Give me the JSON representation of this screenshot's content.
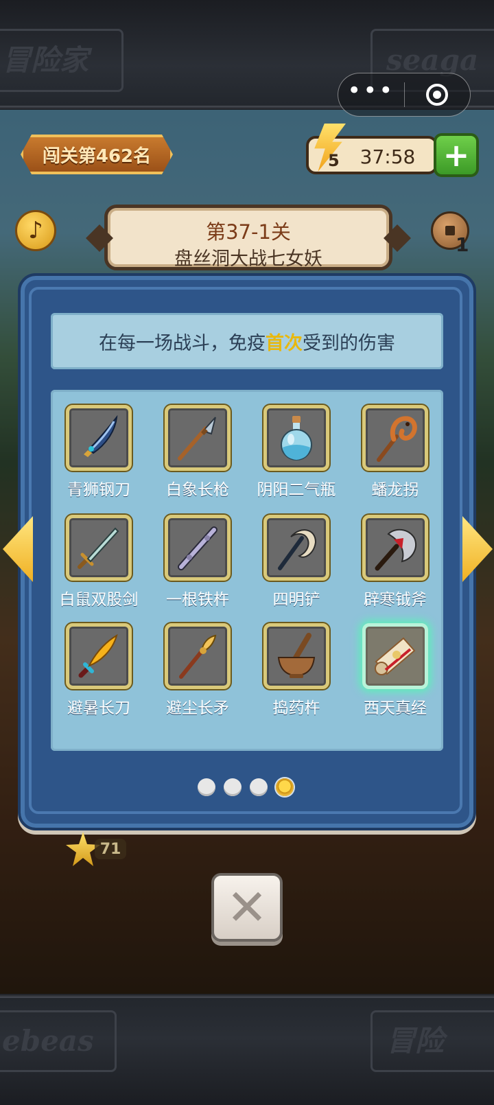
{
  "header": {
    "deco_left_text": "冒险家",
    "deco_right_text": "seaga",
    "capsule": {
      "more_icon": "more-dots-icon",
      "close_icon": "target-icon"
    }
  },
  "hud": {
    "rank_label": "闯关第462名",
    "energy_count": "5",
    "energy_timer": "37:58",
    "plus_label": "+",
    "music_icon": "♪",
    "coin_count": "1"
  },
  "stage": {
    "number": "第37-1关",
    "name": "盘丝洞大战七女妖"
  },
  "popup": {
    "description_before": "在每一场战斗，免疫",
    "description_highlight": "首次",
    "description_after": "受到的伤害",
    "items": [
      {
        "name": "青狮钢刀",
        "icon": "blade-icon"
      },
      {
        "name": "白象长枪",
        "icon": "spear-icon"
      },
      {
        "name": "阴阳二气瓶",
        "icon": "potion-bottle-icon"
      },
      {
        "name": "蟠龙拐",
        "icon": "dragon-staff-icon"
      },
      {
        "name": "白鼠双股剑",
        "icon": "sword-icon"
      },
      {
        "name": "一根铁杵",
        "icon": "iron-rod-icon"
      },
      {
        "name": "四明铲",
        "icon": "crescent-spade-icon"
      },
      {
        "name": "辟寒钺斧",
        "icon": "battle-axe-icon"
      },
      {
        "name": "避暑长刀",
        "icon": "golden-blade-icon"
      },
      {
        "name": "避尘长矛",
        "icon": "ornate-spear-icon"
      },
      {
        "name": "捣药杵",
        "icon": "mortar-pestle-icon"
      },
      {
        "name": "西天真经",
        "icon": "scripture-scroll-icon"
      }
    ],
    "selected_index": 11,
    "pages": 4,
    "active_page": 4
  },
  "footer": {
    "star_count": "71",
    "deco_left_text": "ebeas",
    "deco_right_text": "冒险"
  },
  "colors": {
    "popup_bg": "#2e5589",
    "panel_bg": "#8fc2d9",
    "highlight": "#e8b80e",
    "selected_glow": "#5ef0b8"
  }
}
